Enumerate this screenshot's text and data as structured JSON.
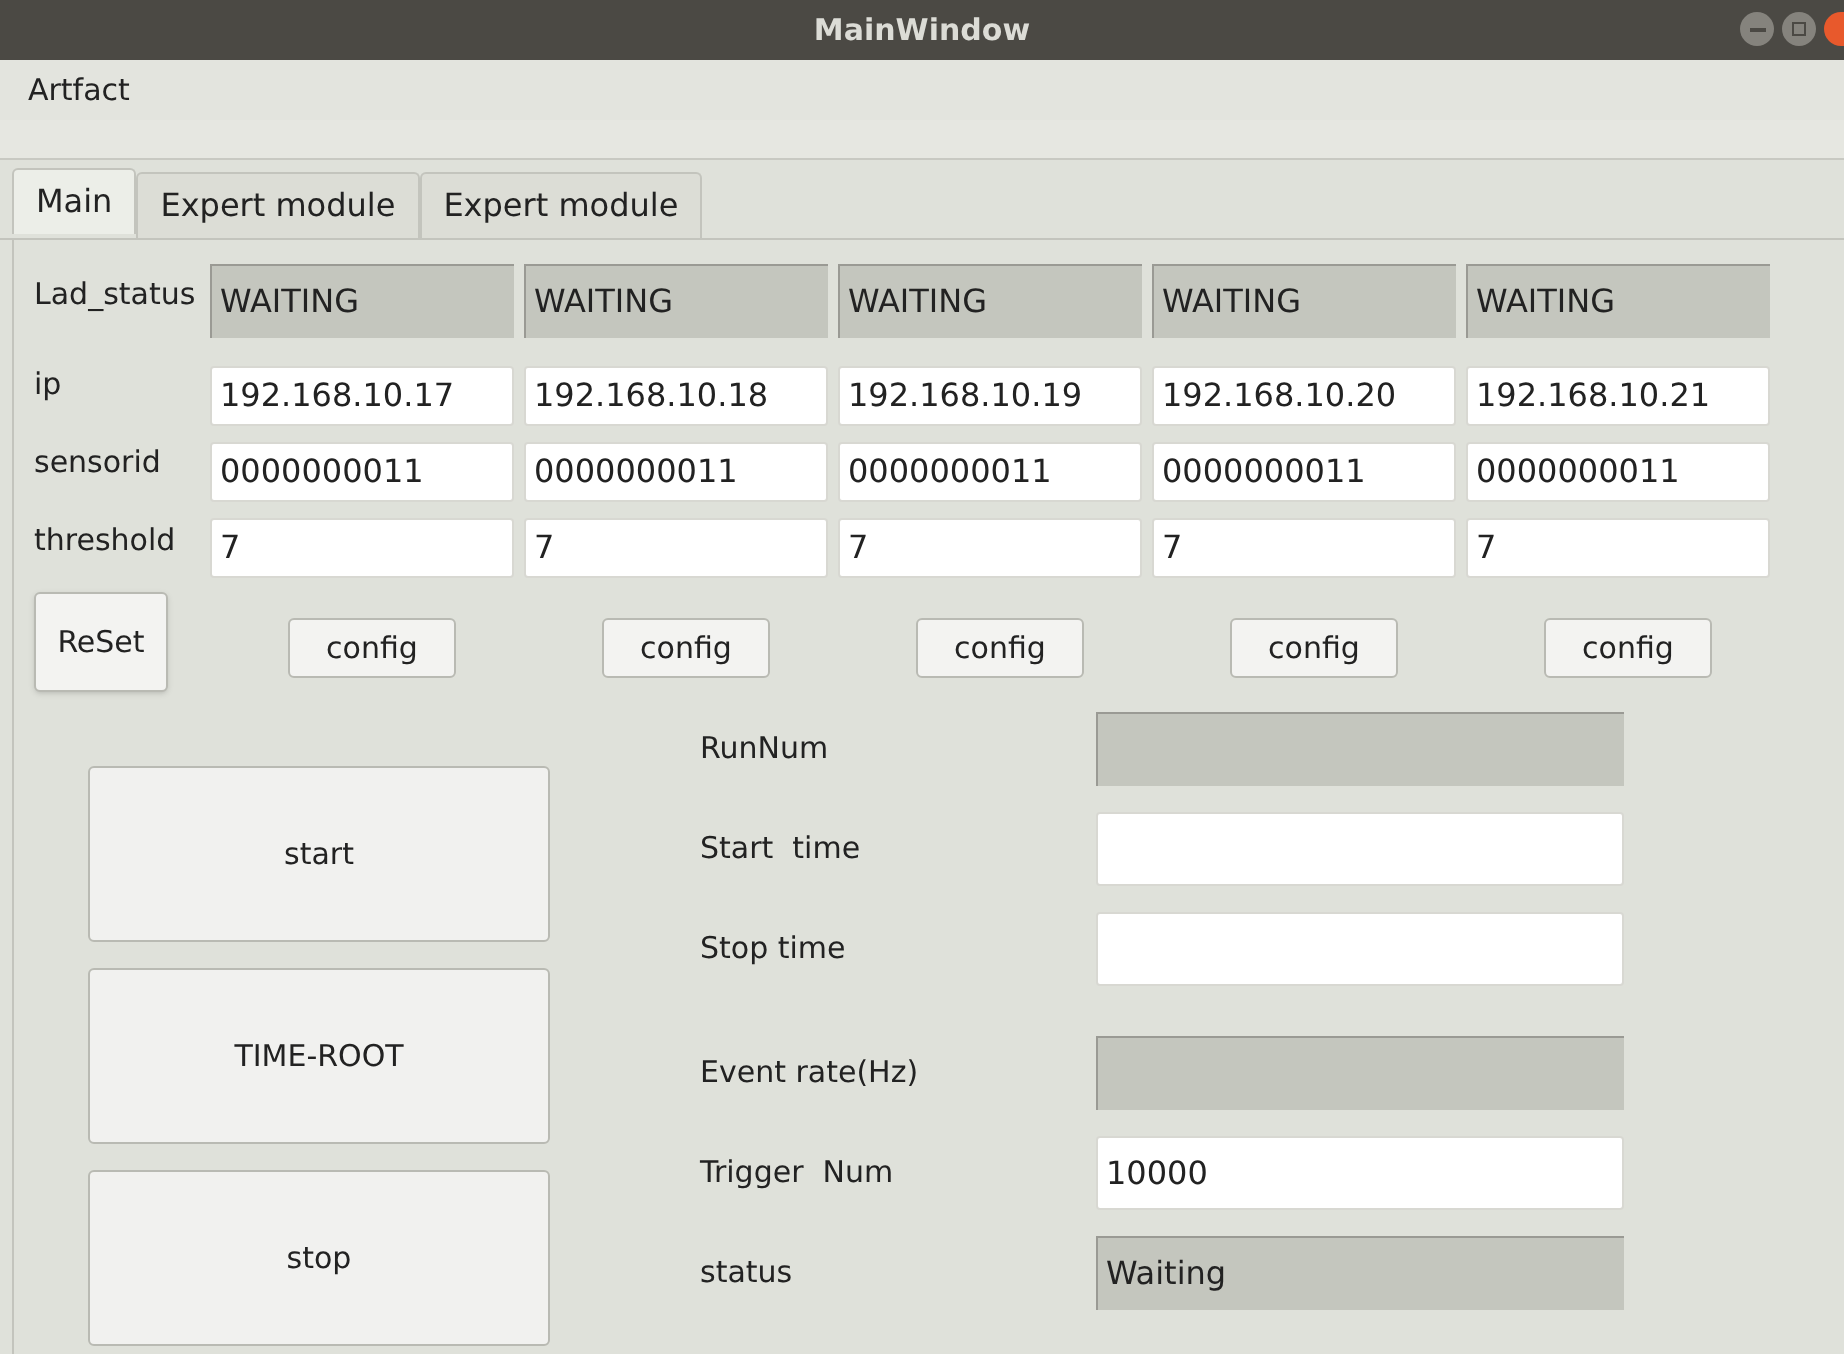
{
  "window": {
    "title": "MainWindow"
  },
  "menu": [
    "Artfact"
  ],
  "tabs": [
    {
      "label": "Main",
      "selected": true
    },
    {
      "label": "Expert module",
      "selected": false
    },
    {
      "label": "Expert module",
      "selected": false
    }
  ],
  "row_labels": [
    "Lad_status",
    "ip",
    "sensorid",
    "threshold"
  ],
  "modules": [
    {
      "status": "WAITING",
      "ip": "192.168.10.17",
      "sensorid": "0000000011",
      "threshold": "7",
      "button": "config"
    },
    {
      "status": "WAITING",
      "ip": "192.168.10.18",
      "sensorid": "0000000011",
      "threshold": "7",
      "button": "config"
    },
    {
      "status": "WAITING",
      "ip": "192.168.10.19",
      "sensorid": "0000000011",
      "threshold": "7",
      "button": "config"
    },
    {
      "status": "WAITING",
      "ip": "192.168.10.20",
      "sensorid": "0000000011",
      "threshold": "7",
      "button": "config"
    },
    {
      "status": "WAITING",
      "ip": "192.168.10.21",
      "sensorid": "0000000011",
      "threshold": "7",
      "button": "config"
    }
  ],
  "reset_button": "ReSet",
  "action_buttons": [
    "start",
    "TIME-ROOT",
    "stop"
  ],
  "info_fields": [
    {
      "label": "RunNum",
      "readonly": true
    },
    {
      "label": "Start  time",
      "readonly": false
    },
    {
      "label": "Stop time",
      "readonly": false
    },
    {
      "label": "Event rate(Hz)",
      "readonly": true
    },
    {
      "label": "Trigger  Num",
      "value": "10000",
      "readonly": false
    },
    {
      "label": "status",
      "value": "Waiting",
      "readonly": true
    }
  ]
}
